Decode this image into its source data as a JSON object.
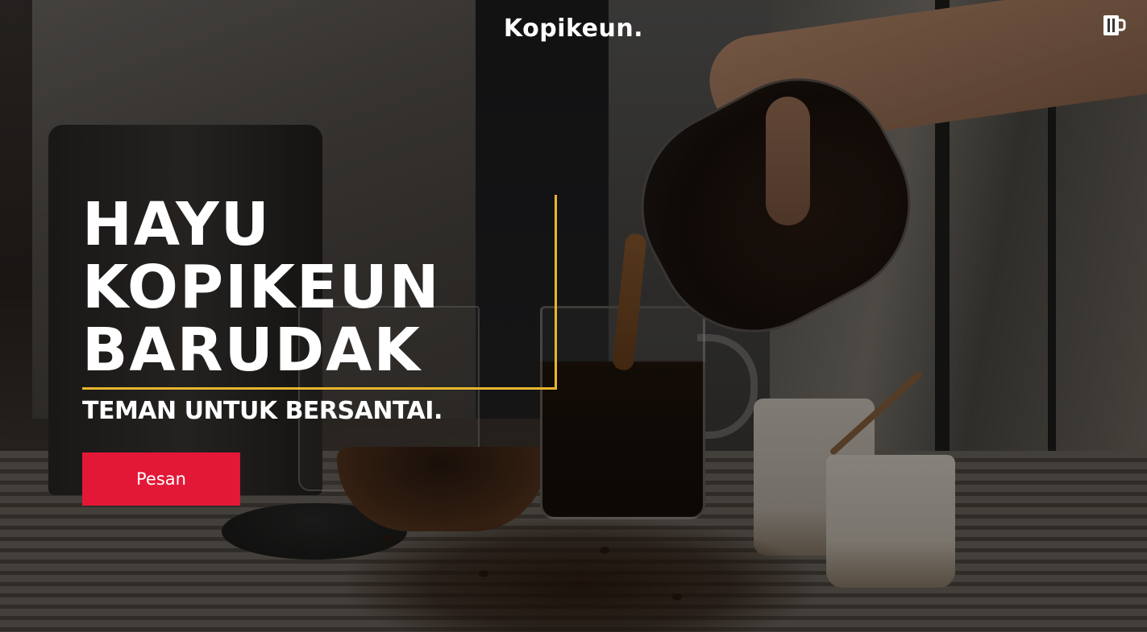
{
  "header": {
    "brand": "Kopikeun.",
    "cart_icon": "coffee-mug-icon"
  },
  "hero": {
    "headline": [
      "HAYU",
      "KOPIKEUN",
      "BARUDAK"
    ],
    "tagline": "TEMAN UNTUK BERSANTAI.",
    "cta_label": "Pesan"
  },
  "colors": {
    "accent_frame": "#e7b62e",
    "cta_background": "#e31837",
    "text": "#ffffff"
  }
}
